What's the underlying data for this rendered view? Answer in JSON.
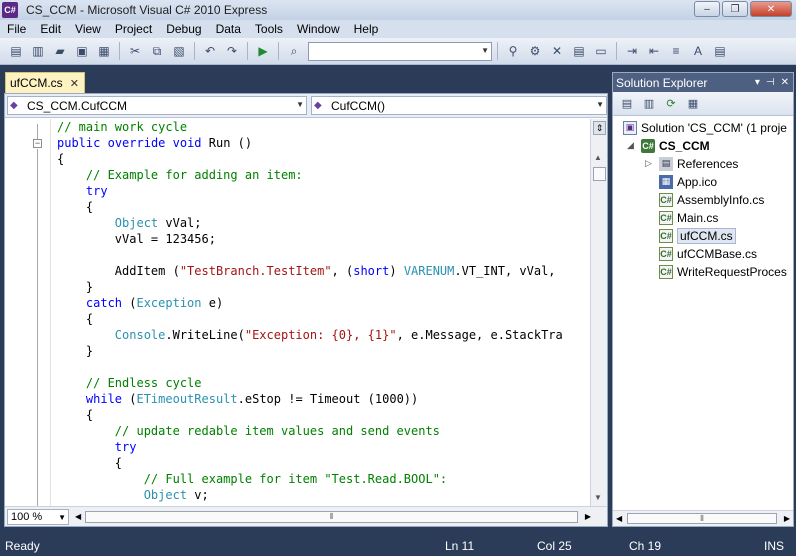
{
  "window": {
    "title": "CS_CCM - Microsoft Visual C# 2010 Express",
    "app_icon_text": "C#",
    "min": "–",
    "max": "❐",
    "close": "✕"
  },
  "menu": [
    "File",
    "Edit",
    "View",
    "Project",
    "Debug",
    "Data",
    "Tools",
    "Window",
    "Help"
  ],
  "toolbar": {
    "icons": [
      "new-project-icon",
      "add-item-icon",
      "open-file-icon",
      "save-icon",
      "save-all-icon",
      "cut-icon",
      "copy-icon",
      "paste-icon",
      "undo-icon",
      "redo-icon",
      "start-debugging-icon",
      "find-in-files-icon",
      "find-icon",
      "properties-icon",
      "toolbox-icon",
      "solution-explorer-icon",
      "start-page-icon",
      "extension-icon"
    ],
    "search_value": ""
  },
  "document": {
    "tab_label": "ufCCM.cs",
    "tab_close": "✕",
    "class_combo": "CS_CCM.CufCCM",
    "member_combo": "CufCCM()"
  },
  "code_lines": [
    [
      {
        "t": "// main work cycle",
        "c": "cm"
      }
    ],
    [
      {
        "t": "public",
        "c": "kw"
      },
      {
        "t": " "
      },
      {
        "t": "override",
        "c": "kw"
      },
      {
        "t": " "
      },
      {
        "t": "void",
        "c": "kw"
      },
      {
        "t": " Run ()"
      }
    ],
    [
      {
        "t": "{"
      }
    ],
    [
      {
        "t": "    "
      },
      {
        "t": "// Example for adding an item:",
        "c": "cm"
      }
    ],
    [
      {
        "t": "    "
      },
      {
        "t": "try",
        "c": "kw"
      }
    ],
    [
      {
        "t": "    {"
      }
    ],
    [
      {
        "t": "        "
      },
      {
        "t": "Object",
        "c": "ty"
      },
      {
        "t": " vVal;"
      }
    ],
    [
      {
        "t": "        vVal = 123456;"
      }
    ],
    [
      {
        "t": ""
      }
    ],
    [
      {
        "t": "        AddItem ("
      },
      {
        "t": "\"TestBranch.TestItem\"",
        "c": "st"
      },
      {
        "t": ", ("
      },
      {
        "t": "short",
        "c": "kw"
      },
      {
        "t": ") "
      },
      {
        "t": "VARENUM",
        "c": "ty"
      },
      {
        "t": ".VT_INT, vVal,"
      }
    ],
    [
      {
        "t": "    }"
      }
    ],
    [
      {
        "t": "    "
      },
      {
        "t": "catch",
        "c": "kw"
      },
      {
        "t": " ("
      },
      {
        "t": "Exception",
        "c": "ty"
      },
      {
        "t": " e)"
      }
    ],
    [
      {
        "t": "    {"
      }
    ],
    [
      {
        "t": "        "
      },
      {
        "t": "Console",
        "c": "ty"
      },
      {
        "t": ".WriteLine("
      },
      {
        "t": "\"Exception: {0}, {1}\"",
        "c": "st"
      },
      {
        "t": ", e.Message, e.StackTra"
      }
    ],
    [
      {
        "t": "    }"
      }
    ],
    [
      {
        "t": ""
      }
    ],
    [
      {
        "t": "    "
      },
      {
        "t": "// Endless cycle",
        "c": "cm"
      }
    ],
    [
      {
        "t": "    "
      },
      {
        "t": "while",
        "c": "kw"
      },
      {
        "t": " ("
      },
      {
        "t": "ETimeoutResult",
        "c": "ty"
      },
      {
        "t": ".eStop != Timeout (1000))"
      }
    ],
    [
      {
        "t": "    {"
      }
    ],
    [
      {
        "t": "        "
      },
      {
        "t": "// update redable item values and send events",
        "c": "cm"
      }
    ],
    [
      {
        "t": "        "
      },
      {
        "t": "try",
        "c": "kw"
      }
    ],
    [
      {
        "t": "        {"
      }
    ],
    [
      {
        "t": "            "
      },
      {
        "t": "// Full example for item \"Test.Read.BOOL\":",
        "c": "cm"
      }
    ],
    [
      {
        "t": "            "
      },
      {
        "t": "Object",
        "c": "ty"
      },
      {
        "t": " v;"
      }
    ]
  ],
  "editor": {
    "zoom": "100 %",
    "fold_glyph": "−"
  },
  "solution_explorer": {
    "title": "Solution Explorer",
    "header_controls": [
      "▾",
      "⊣",
      "✕"
    ],
    "toolbar_icons": [
      "properties-icon",
      "show-all-files-icon",
      "refresh-icon",
      "view-class-diagram-icon"
    ],
    "items": [
      {
        "label": "Solution 'CS_CCM' (1 proje",
        "icon": "solution-icon",
        "glyph": "▣",
        "kind": "ic-sol",
        "indent": 0,
        "bold": false,
        "expander": ""
      },
      {
        "label": "CS_CCM",
        "icon": "csharp-project-icon",
        "glyph": "C#",
        "kind": "ic-proj",
        "indent": 1,
        "bold": true,
        "expander": "◢"
      },
      {
        "label": "References",
        "icon": "references-icon",
        "glyph": "▤",
        "kind": "ic-ref",
        "indent": 2,
        "bold": false,
        "expander": "▷"
      },
      {
        "label": "App.ico",
        "icon": "icon-file-icon",
        "glyph": "▦",
        "kind": "ic-ico",
        "indent": 2,
        "bold": false,
        "expander": ""
      },
      {
        "label": "AssemblyInfo.cs",
        "icon": "cs-file-icon",
        "glyph": "C#",
        "kind": "ic-cs",
        "indent": 2,
        "bold": false,
        "expander": ""
      },
      {
        "label": "Main.cs",
        "icon": "cs-file-icon",
        "glyph": "C#",
        "kind": "ic-cs",
        "indent": 2,
        "bold": false,
        "expander": ""
      },
      {
        "label": "ufCCM.cs",
        "icon": "cs-file-icon",
        "glyph": "C#",
        "kind": "ic-cs",
        "indent": 2,
        "bold": false,
        "expander": "",
        "selected": true
      },
      {
        "label": "ufCCMBase.cs",
        "icon": "cs-file-icon",
        "glyph": "C#",
        "kind": "ic-cs",
        "indent": 2,
        "bold": false,
        "expander": ""
      },
      {
        "label": "WriteRequestProces",
        "icon": "cs-file-icon",
        "glyph": "C#",
        "kind": "ic-cs",
        "indent": 2,
        "bold": false,
        "expander": ""
      }
    ]
  },
  "status": {
    "ready": "Ready",
    "ln": "Ln 11",
    "col": "Col 25",
    "ch": "Ch 19",
    "ins": "INS"
  },
  "colors": {
    "keyword": "#0000ff",
    "type": "#2b91af",
    "comment": "#008000",
    "string": "#a31515",
    "statusbar": "#2b3c59",
    "tab_active": "#fdf3c2"
  }
}
